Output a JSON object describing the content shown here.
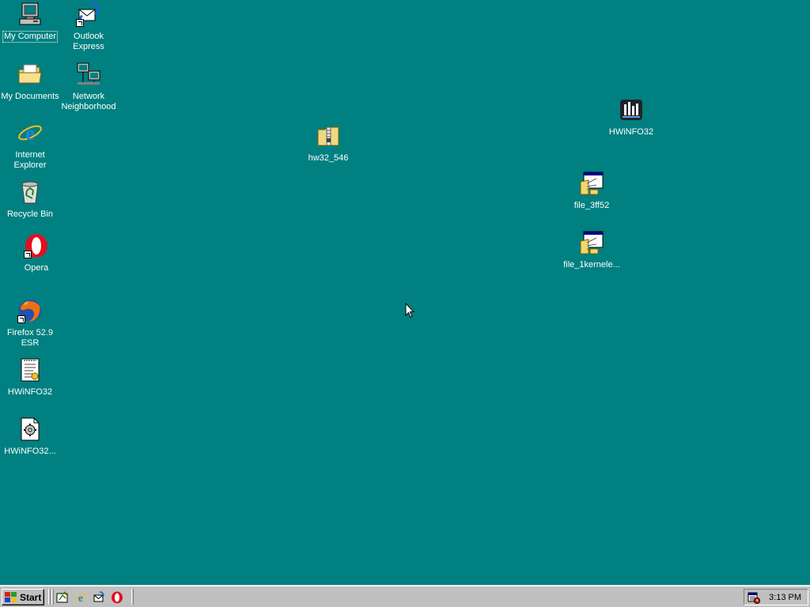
{
  "desktop": {
    "background": "#008080",
    "icons": {
      "my_computer": "My Computer",
      "outlook": "Outlook Express",
      "my_documents": "My Documents",
      "network": "Network Neighborhood",
      "ie": "Internet Explorer",
      "recycle": "Recycle Bin",
      "opera": "Opera",
      "firefox": "Firefox 52.9 ESR",
      "hwinfo_txt": "HWiNFO32",
      "hwinfo_cfg": "HWiNFO32...",
      "hw32_zip": "hw32_546",
      "hwinfo_app": "HWiNFO32",
      "file_3ff52": "file_3ff52",
      "file_1kernel": "file_1kernele..."
    }
  },
  "taskbar": {
    "start_label": "Start",
    "quick_launch": [
      "show-desktop-icon",
      "ie-icon",
      "outlook-icon",
      "opera-icon"
    ],
    "clock": "3:13 PM",
    "tray_icon": "task-scheduler-icon"
  }
}
